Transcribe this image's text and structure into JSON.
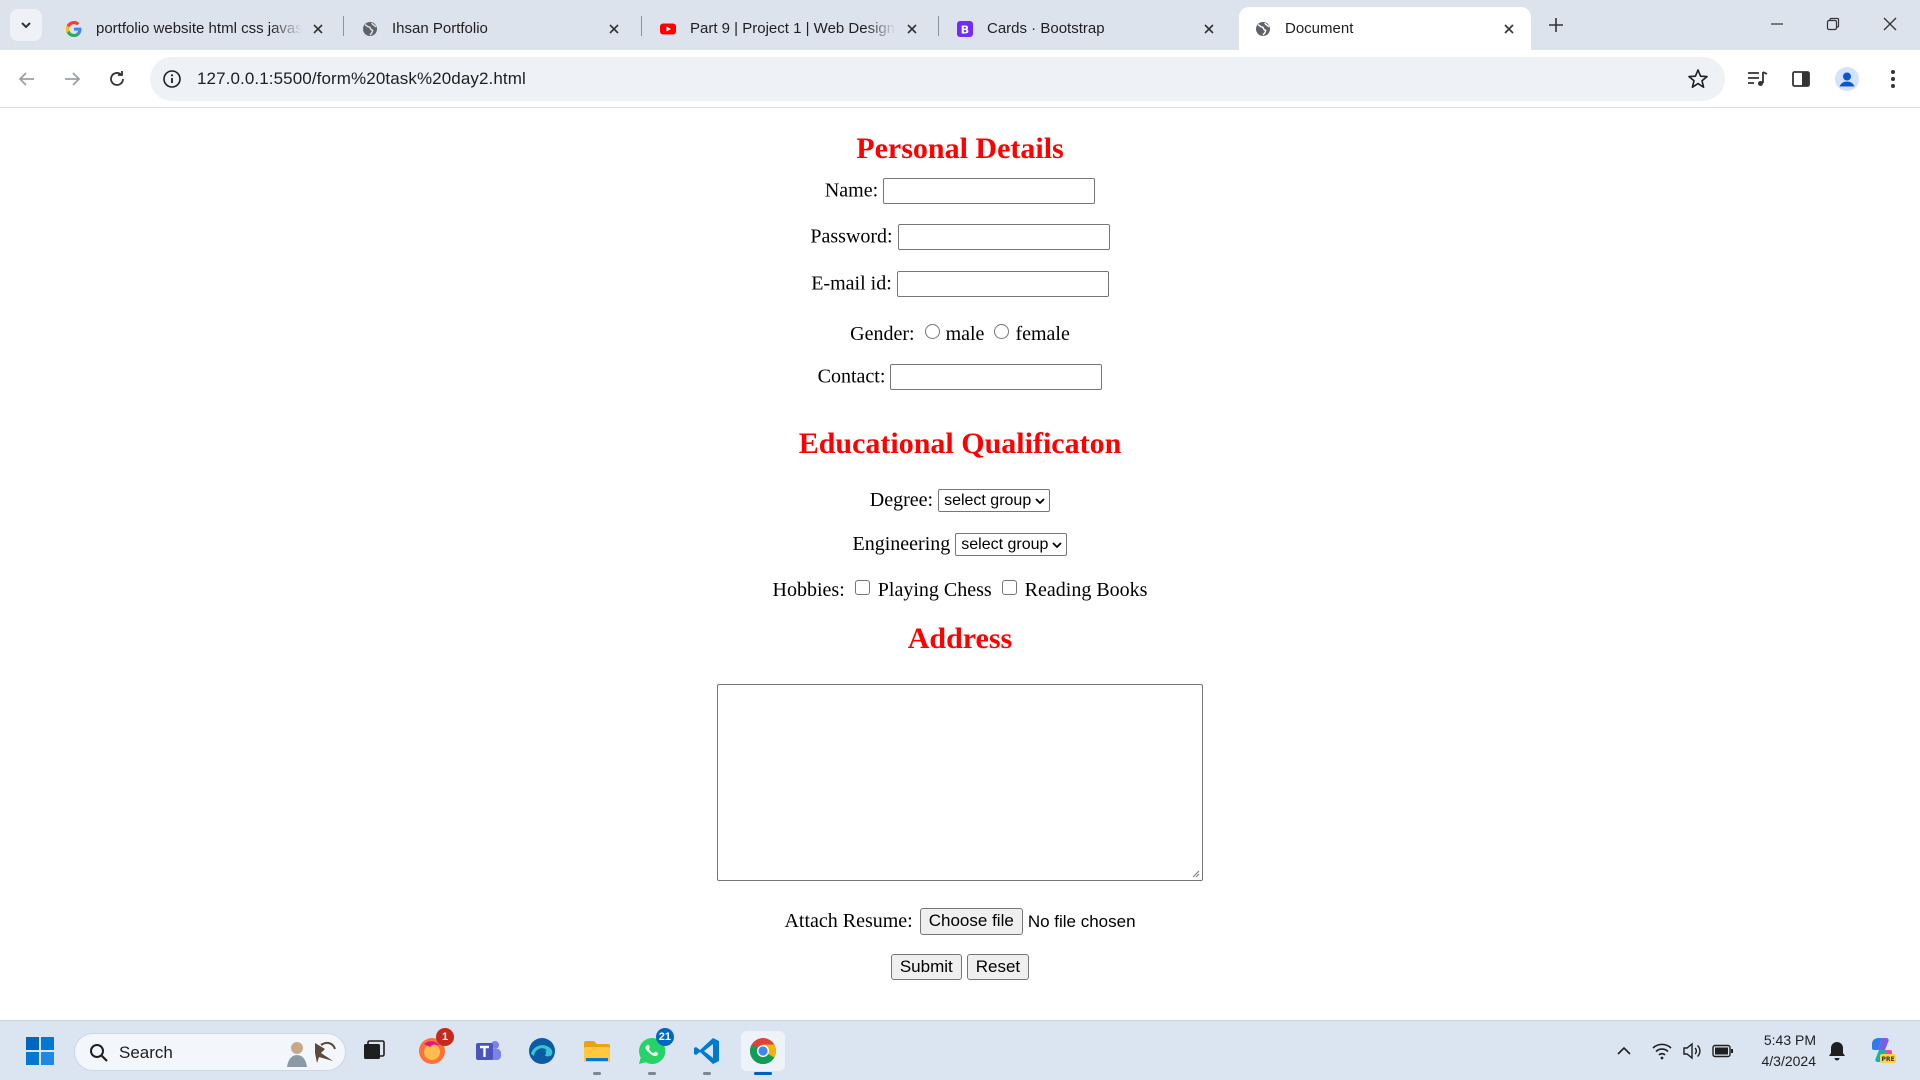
{
  "browser": {
    "tabs": [
      {
        "title": "portfolio website html css javascript",
        "icon": "google-icon"
      },
      {
        "title": "Ihsan Portfolio",
        "icon": "globe-icon"
      },
      {
        "title": "Part 9 | Project 1 | Web Designing",
        "icon": "youtube-icon"
      },
      {
        "title": "Cards · Bootstrap",
        "icon": "bootstrap-icon"
      },
      {
        "title": "Document",
        "icon": "globe-icon",
        "active": true
      }
    ],
    "url": "127.0.0.1:5500/form%20task%20day2.html"
  },
  "form": {
    "personal_heading": "Personal Details",
    "name_label": "Name:",
    "password_label": "Password:",
    "email_label": "E-mail id:",
    "gender_label": "Gender:",
    "gender_options": [
      "male",
      "female"
    ],
    "contact_label": "Contact:",
    "education_heading": "Educational Qualificaton",
    "degree_label": "Degree:",
    "degree_value": "select group",
    "engineering_label": "Engineering",
    "engineering_value": "select group",
    "hobbies_label": "Hobbies:",
    "hobby_options": [
      "Playing Chess",
      "Reading Books"
    ],
    "address_heading": "Address",
    "resume_label": "Attach Resume:",
    "choose_file_label": "Choose file",
    "no_file_text": "No file chosen",
    "submit_label": "Submit",
    "reset_label": "Reset"
  },
  "taskbar": {
    "search_label": "Search",
    "badges": {
      "firefox": "1",
      "whatsapp": "21"
    },
    "time": "5:43 PM",
    "date": "4/3/2024"
  },
  "colors": {
    "heading": "#ff0000",
    "tabstrip": "#dde3ec",
    "taskbar": "#dbe5f1"
  }
}
